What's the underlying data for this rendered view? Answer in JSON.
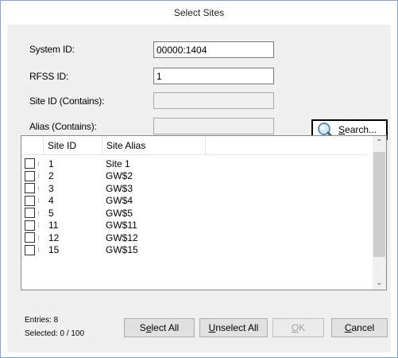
{
  "window": {
    "title": "Select Sites"
  },
  "form": {
    "system_id": {
      "label": "System ID:",
      "value": "00000:1404"
    },
    "rfss_id": {
      "label": "RFSS ID:",
      "value": "1"
    },
    "site_id": {
      "label": "Site ID (Contains):",
      "value": ""
    },
    "alias": {
      "label": "Alias (Contains):",
      "value": ""
    },
    "search_button": {
      "label_pre": "",
      "label_mnemonic": "S",
      "label_post": "earch..."
    }
  },
  "list": {
    "columns": [
      "Site ID",
      "Site Alias"
    ],
    "rows": [
      {
        "id": "1",
        "alias": "Site 1"
      },
      {
        "id": "2",
        "alias": "GW$2"
      },
      {
        "id": "3",
        "alias": "GW$3"
      },
      {
        "id": "4",
        "alias": "GW$4"
      },
      {
        "id": "5",
        "alias": "GW$5"
      },
      {
        "id": "11",
        "alias": "GW$11"
      },
      {
        "id": "12",
        "alias": "GW$12"
      },
      {
        "id": "15",
        "alias": "GW$15"
      }
    ]
  },
  "footer": {
    "entries": "Entries: 8",
    "selected": "Selected: 0 / 100",
    "select_all": {
      "pre": "S",
      "mnemonic": "e",
      "post": "lect All"
    },
    "unselect_all": {
      "pre": "",
      "mnemonic": "U",
      "post": "nselect All"
    },
    "ok": {
      "pre": "",
      "mnemonic": "O",
      "post": "K"
    },
    "cancel": {
      "pre": "",
      "mnemonic": "C",
      "post": "ancel"
    }
  }
}
